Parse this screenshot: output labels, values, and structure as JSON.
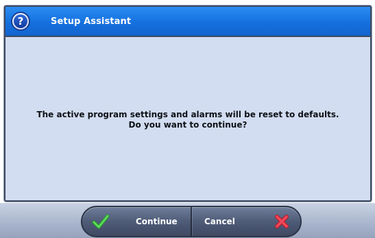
{
  "window": {
    "title": "Setup Assistant",
    "help_icon": "question-mark-icon"
  },
  "message": {
    "line1": "The active program settings and alarms will be reset to defaults.",
    "line2": "Do you want to continue?"
  },
  "buttons": {
    "continue": {
      "label": "Continue",
      "icon": "checkmark-icon"
    },
    "cancel": {
      "label": "Cancel",
      "icon": "x-icon"
    }
  },
  "colors": {
    "title_bar": "#1570de",
    "dialog_bg": "#d3ddf1",
    "button_bar": "#4f5c78",
    "check": "#3fbf3f",
    "cancel_x": "#e23a4a"
  }
}
